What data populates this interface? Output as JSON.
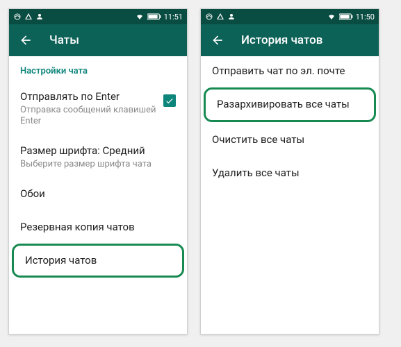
{
  "screens": [
    {
      "status": {
        "time": "11:51"
      },
      "appbar": {
        "title": "Чаты"
      },
      "section_header": "Настройки чата",
      "items": [
        {
          "title": "Отправлять по Enter",
          "sub": "Отправка сообщений клавишей Enter",
          "checked": true
        },
        {
          "title": "Размер шрифта: Средний",
          "sub": "Выберите размер шрифта чата"
        },
        {
          "title": "Обои"
        },
        {
          "title": "Резервная копия чатов"
        },
        {
          "title": "История чатов",
          "highlight": true
        }
      ]
    },
    {
      "status": {
        "time": "11:50"
      },
      "appbar": {
        "title": "История чатов"
      },
      "items": [
        {
          "title": "Отправить чат по эл. почте"
        },
        {
          "title": "Разархивировать все чаты",
          "highlight": true
        },
        {
          "title": "Очистить все чаты"
        },
        {
          "title": "Удалить все чаты"
        }
      ]
    }
  ]
}
